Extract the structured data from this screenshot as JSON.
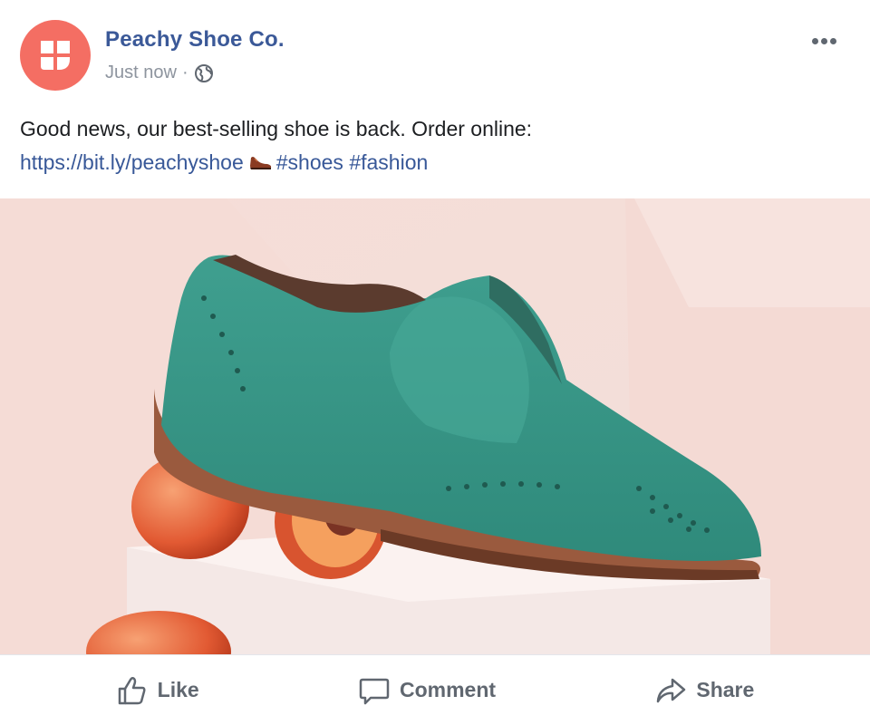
{
  "post": {
    "page_name": "Peachy Shoe Co.",
    "timestamp": "Just now",
    "separator": "·",
    "privacy_icon": "globe-icon",
    "more_icon": "more-options-icon",
    "text_line1": "Good news, our best-selling shoe is back. Order online:",
    "link_text": "https://bit.ly/peachyshoe",
    "emoji": "shoe-emoji",
    "hashtag1": "#shoes",
    "hashtag2": "#fashion",
    "image_alt": "Teal suede brogue shoe resting on peaches on a pink platform"
  },
  "actions": {
    "like_label": "Like",
    "comment_label": "Comment",
    "share_label": "Share"
  },
  "colors": {
    "brand": "#f46e63",
    "link": "#385898",
    "name": "#3b5998",
    "muted": "#606770"
  }
}
